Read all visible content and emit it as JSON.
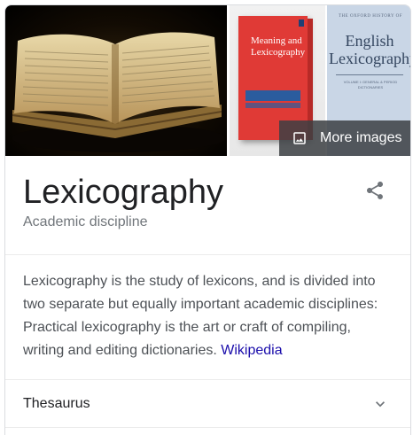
{
  "images": {
    "more_images_label": "More images",
    "book1_title": "Meaning and Lexicography",
    "book2_header": "THE OXFORD HISTORY OF",
    "book2_title": "English Lexicography",
    "book2_sub": "VOLUME I: GENERAL & PERIOD DICTIONARIES"
  },
  "header": {
    "title": "Lexicography",
    "subtitle": "Academic discipline"
  },
  "description": {
    "text": "Lexicography is the study of lexicons, and is divided into two separate but equally important academic disciplines: Practical lexicography is the art or craft of compiling, writing and editing dictionaries.",
    "source_link": "Wikipedia"
  },
  "related": [
    {
      "label": "Thesaurus"
    }
  ],
  "icons": {
    "share": "share-icon",
    "image": "image-icon",
    "chevron": "chevron-down-icon"
  },
  "colors": {
    "link": "#1a0dab",
    "subtitle": "#70757a",
    "text": "#4d5156"
  }
}
